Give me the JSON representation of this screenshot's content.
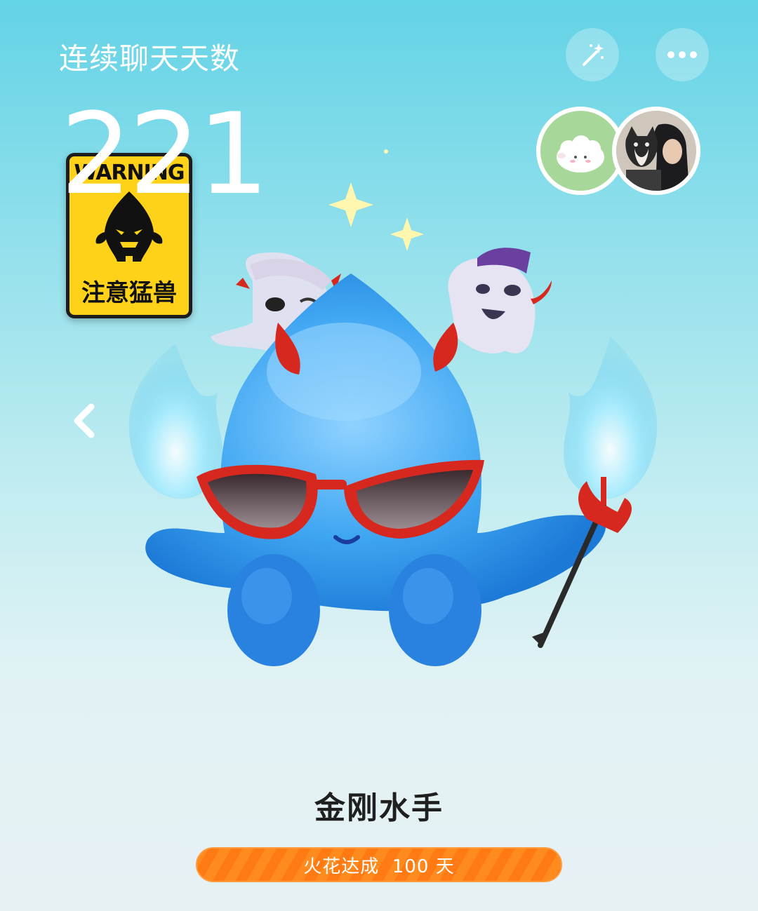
{
  "header": {
    "title": "连续聊天天数",
    "magic_icon": "magic-wand-icon",
    "more_icon": "more-dots-icon"
  },
  "streak": {
    "days": "221"
  },
  "badge": {
    "top_text": "WARNING",
    "bottom_text": "注意猛兽"
  },
  "mascot": {
    "name": "金刚水手"
  },
  "milestone": {
    "label": "火花达成  100 天"
  },
  "nav": {
    "prev_icon": "chevron-left-icon"
  },
  "colors": {
    "accent_orange": "#ff8a1e",
    "mascot_blue": "#3a9ff0",
    "badge_yellow": "#ffd21a"
  }
}
